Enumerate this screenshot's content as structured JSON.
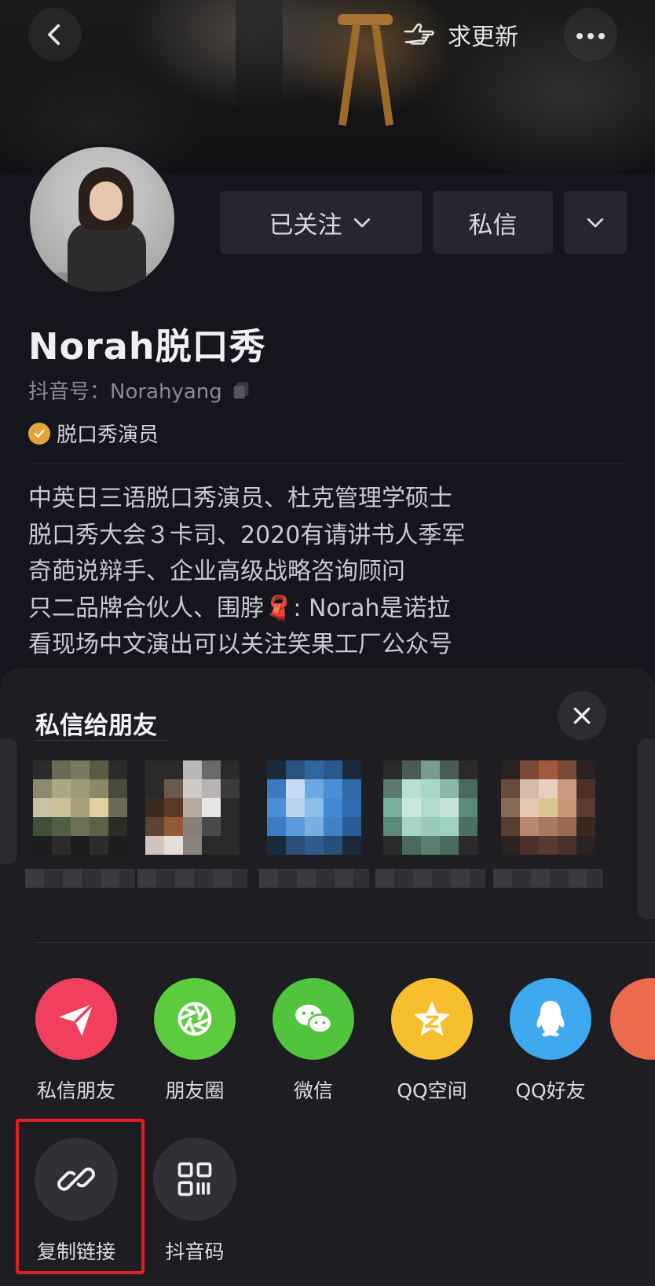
{
  "topbar": {
    "back_icon": "chevron-left-icon",
    "update_label": "求更新",
    "update_icon": "pointing-hand-icon",
    "more_icon": "more-horizontal-icon"
  },
  "profile": {
    "follow_label": "已关注",
    "message_label": "私信",
    "name": "Norah脱口秀",
    "douyin_id": "抖音号：Norahyang",
    "verify_label": "脱口秀演员",
    "bio": [
      "中英日三语脱口秀演员、杜克管理学硕士",
      "脱口秀大会３卡司、2020有请讲书人季军",
      "奇葩说辩手、企业高级战略咨询顾问",
      "只二品牌合伙人、围脖🧣: Norah是诺拉",
      "看现场中文演出可以关注笑果工厂公众号"
    ]
  },
  "share_sheet": {
    "title": "私信给朋友",
    "share_targets": [
      {
        "label": "私信朋友",
        "icon": "paper-plane-icon",
        "color": "#f0405e"
      },
      {
        "label": "朋友圈",
        "icon": "moments-shutter-icon",
        "color": "#5ccc3e"
      },
      {
        "label": "微信",
        "icon": "wechat-icon",
        "color": "#4fc43c"
      },
      {
        "label": "QQ空间",
        "icon": "qzone-star-icon",
        "color": "#f7bf2e"
      },
      {
        "label": "QQ好友",
        "icon": "qq-penguin-icon",
        "color": "#3ea9ef"
      }
    ],
    "tools": [
      {
        "label": "复制链接",
        "icon": "link-icon"
      },
      {
        "label": "抖音码",
        "icon": "qr-code-icon"
      }
    ]
  }
}
